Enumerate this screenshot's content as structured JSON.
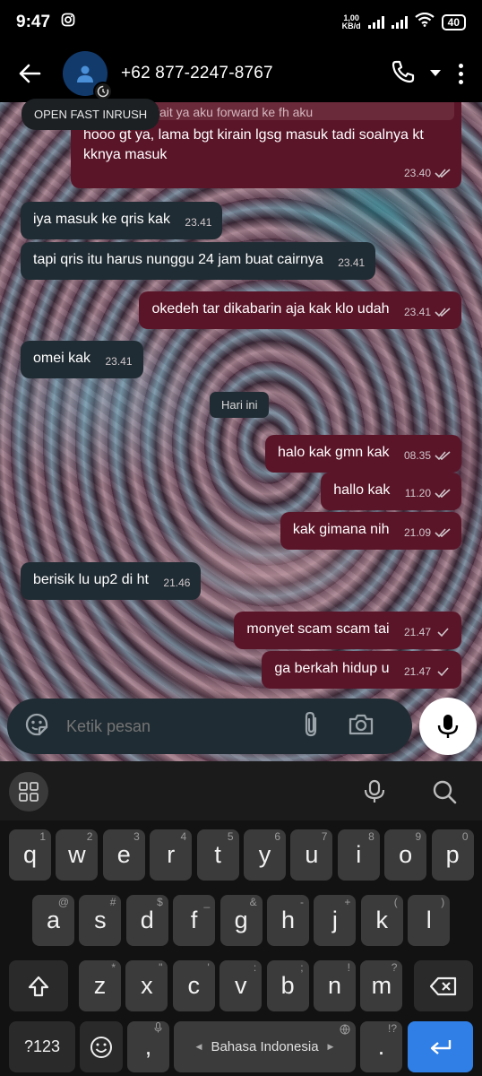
{
  "status_bar": {
    "time": "9:47",
    "net_speed_value": "1,00",
    "net_speed_unit": "KB/d",
    "battery": "40"
  },
  "header": {
    "contact": "+62 877-2247-8767"
  },
  "popup": {
    "label": "OPEN FAST INRUSH"
  },
  "chat": {
    "quoted_text": "k wait ya aku forward ke fh aku",
    "date_chip": "Hari ini",
    "messages": [
      {
        "dir": "out",
        "text": "hooo gt ya, lama bgt kirain lgsg masuk tadi soalnya kt kknya masuk",
        "time": "23.40",
        "status": "read"
      },
      {
        "dir": "in",
        "text": "iya masuk ke qris kak",
        "time": "23.41"
      },
      {
        "dir": "in",
        "text": "tapi qris itu harus nunggu 24 jam buat cairnya",
        "time": "23.41"
      },
      {
        "dir": "out",
        "text": "okedeh tar dikabarin aja kak klo udah",
        "time": "23.41",
        "status": "read"
      },
      {
        "dir": "in",
        "text": "omei kak",
        "time": "23.41"
      },
      {
        "dir": "out",
        "text": "halo kak gmn kak",
        "time": "08.35",
        "status": "read"
      },
      {
        "dir": "out",
        "text": "hallo kak",
        "time": "11.20",
        "status": "read"
      },
      {
        "dir": "out",
        "text": "kak gimana nih",
        "time": "21.09",
        "status": "read"
      },
      {
        "dir": "in",
        "text": "berisik lu up2 di ht",
        "time": "21.46"
      },
      {
        "dir": "out",
        "text": "monyet scam scam tai",
        "time": "21.47",
        "status": "sent"
      },
      {
        "dir": "out",
        "text": "ga berkah hidup u",
        "time": "21.47",
        "status": "sent"
      }
    ]
  },
  "composer": {
    "placeholder": "Ketik pesan"
  },
  "keyboard": {
    "row1": [
      {
        "k": "q",
        "h": "1"
      },
      {
        "k": "w",
        "h": "2"
      },
      {
        "k": "e",
        "h": "3"
      },
      {
        "k": "r",
        "h": "4"
      },
      {
        "k": "t",
        "h": "5"
      },
      {
        "k": "y",
        "h": "6"
      },
      {
        "k": "u",
        "h": "7"
      },
      {
        "k": "i",
        "h": "8"
      },
      {
        "k": "o",
        "h": "9"
      },
      {
        "k": "p",
        "h": "0"
      }
    ],
    "row2": [
      {
        "k": "a",
        "h": "@"
      },
      {
        "k": "s",
        "h": "#"
      },
      {
        "k": "d",
        "h": "$"
      },
      {
        "k": "f",
        "h": "_"
      },
      {
        "k": "g",
        "h": "&"
      },
      {
        "k": "h",
        "h": "-"
      },
      {
        "k": "j",
        "h": "+"
      },
      {
        "k": "k",
        "h": "("
      },
      {
        "k": "l",
        "h": ")"
      }
    ],
    "row3": [
      {
        "k": "z",
        "h": "*"
      },
      {
        "k": "x",
        "h": "\""
      },
      {
        "k": "c",
        "h": "'"
      },
      {
        "k": "v",
        "h": ":"
      },
      {
        "k": "b",
        "h": ";"
      },
      {
        "k": "n",
        "h": "!"
      },
      {
        "k": "m",
        "h": "?"
      }
    ],
    "symbols_key": "?123",
    "comma_key": ",",
    "space_label": "Bahasa Indonesia",
    "period_key": ".",
    "period_hint": "!?"
  }
}
